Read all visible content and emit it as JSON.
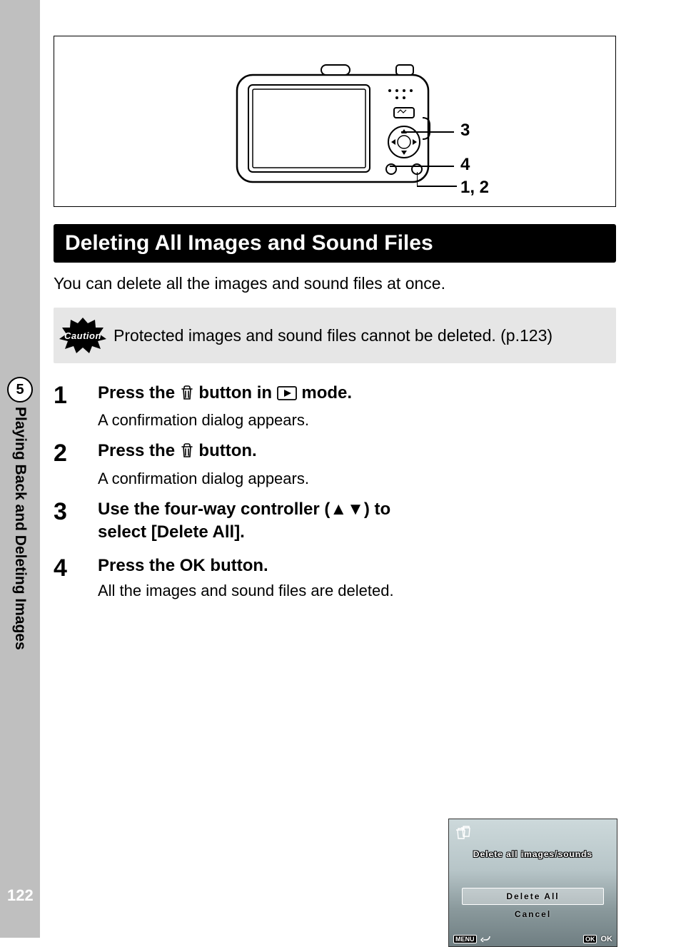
{
  "page_number": "122",
  "chapter_number": "5",
  "chapter_title": "Playing Back and Deleting Images",
  "diagram": {
    "label_3": "3",
    "label_4": "4",
    "label_12": "1, 2"
  },
  "section_heading": "Deleting All Images and Sound Files",
  "intro_text": "You can delete all the images and sound files at once.",
  "caution_label": "Caution",
  "caution_text": "Protected images and sound files cannot be deleted. (p.123)",
  "steps": {
    "s1": {
      "num": "1",
      "title_before": "Press the ",
      "title_mid": " button in ",
      "title_after": " mode.",
      "desc": "A confirmation dialog appears."
    },
    "s2": {
      "num": "2",
      "title_before": "Press the ",
      "title_after": " button.",
      "desc": "A confirmation dialog appears."
    },
    "s3": {
      "num": "3",
      "title": "Use the four-way controller (▲▼) to select [Delete All]."
    },
    "s4": {
      "num": "4",
      "title_before": "Press the ",
      "ok_text": "OK",
      "title_after": " button.",
      "desc": "All the images and sound files are deleted."
    }
  },
  "lcd": {
    "title": "Delete all images/sounds",
    "option_delete_all": "Delete All",
    "option_cancel": "Cancel",
    "menu_label": "MENU",
    "ok_label": "OK",
    "ok_text": "OK"
  }
}
